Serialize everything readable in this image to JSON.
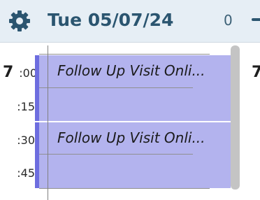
{
  "header": {
    "settings_icon": "gear-icon",
    "date": "Tue 05/07/24",
    "count": "0",
    "colors": {
      "background": "#e6eef5",
      "accent": "#2b5570"
    }
  },
  "timeline": {
    "hour": "7",
    "ticks": [
      ":00",
      ":15",
      ":30",
      ":45"
    ],
    "next_hour": "7"
  },
  "appointments": [
    {
      "title": "Follow Up Visit Onli...",
      "color": "#b3b3ee",
      "border_color": "#6d6ddf"
    },
    {
      "title": "Follow Up Visit Onli...",
      "color": "#b3b3ee",
      "border_color": "#6d6ddf"
    }
  ]
}
